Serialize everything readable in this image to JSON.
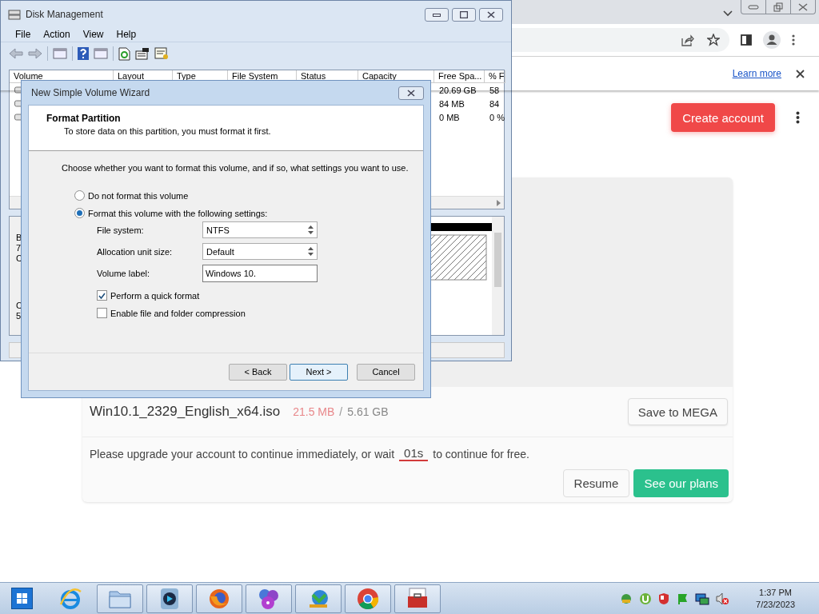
{
  "browser": {
    "info_bar": {
      "link": "Learn more"
    },
    "page": {
      "create_account": "Create account",
      "file": {
        "name": "Win10.1_2329_English_x64.iso",
        "downloaded": "21.5 MB",
        "separator": "/",
        "total": "5.61 GB",
        "save_button": "Save to MEGA"
      },
      "notice": {
        "before": "Please upgrade your account to continue immediately, or wait",
        "countdown": "01s",
        "after": "to continue for free."
      },
      "buttons": [
        {
          "label": "Resume",
          "kind": "secondary"
        },
        {
          "label": "See our plans",
          "kind": "primary"
        }
      ]
    }
  },
  "disk_management": {
    "title": "Disk Management",
    "menu": [
      "File",
      "Action",
      "View",
      "Help"
    ],
    "columns": [
      "Volume",
      "Layout",
      "Type",
      "File System",
      "Status",
      "Capacity",
      "Free Spa...",
      "% F"
    ],
    "rows": [
      {
        "free_space": "20.69 GB",
        "percent_free": "58"
      },
      {
        "free_space": "84 MB",
        "percent_free": "84"
      },
      {
        "free_space": "0 MB",
        "percent_free": "0 %"
      }
    ],
    "disk_labels": [
      [
        "B",
        "7",
        "C"
      ],
      [
        "C",
        "5"
      ]
    ]
  },
  "wizard": {
    "title": "New Simple Volume Wizard",
    "heading": "Format Partition",
    "subheading": "To store data on this partition, you must format it first.",
    "instruction": "Choose whether you want to format this volume, and if so, what settings you want to use.",
    "options": [
      {
        "label": "Do not format this volume",
        "selected": false
      },
      {
        "label": "Format this volume with the following settings:",
        "selected": true
      }
    ],
    "fields": [
      {
        "label": "File system:",
        "kind": "select",
        "value": "NTFS"
      },
      {
        "label": "Allocation unit size:",
        "kind": "select",
        "value": "Default"
      },
      {
        "label": "Volume label:",
        "kind": "text",
        "value": "Windows 10."
      }
    ],
    "checkboxes": [
      {
        "label": "Perform a quick format",
        "checked": true
      },
      {
        "label": "Enable file and folder compression",
        "checked": false
      }
    ],
    "buttons": [
      {
        "label": "< Back",
        "default": false
      },
      {
        "label": "Next >",
        "default": true
      },
      {
        "label": "Cancel",
        "default": false
      }
    ]
  },
  "taskbar": {
    "apps": [
      {
        "kind": "ie",
        "running": false
      },
      {
        "kind": "folder",
        "running": true
      },
      {
        "kind": "player",
        "running": true
      },
      {
        "kind": "firefox",
        "running": true
      },
      {
        "kind": "disc",
        "running": true
      },
      {
        "kind": "download",
        "running": true
      },
      {
        "kind": "chrome",
        "running": true
      },
      {
        "kind": "toolbox",
        "running": true
      }
    ],
    "clock": {
      "time": "1:37 PM",
      "date": "7/23/2023"
    }
  }
}
